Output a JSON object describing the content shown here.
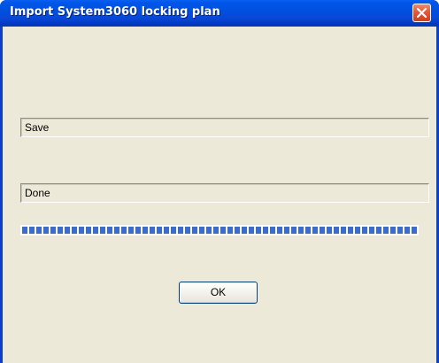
{
  "window": {
    "title": "Import System3060 locking plan"
  },
  "dialog": {
    "status_text": "Save",
    "result_text": "Done",
    "progress_fraction": 1.0,
    "ok_label": "OK"
  },
  "colors": {
    "titlebar": "#0a46d6",
    "dialog_background": "#ece9d8",
    "progress_segment": "#3a6bd1",
    "close_button": "#e2583a"
  }
}
